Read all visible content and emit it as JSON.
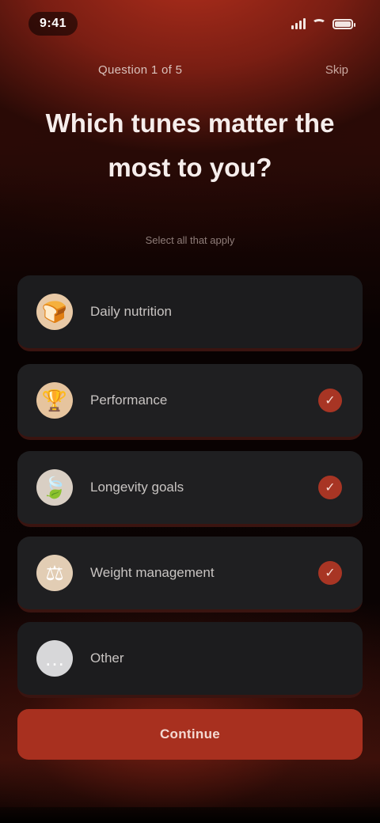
{
  "status_bar": {
    "time": "9:41",
    "icons": [
      "signal-icon",
      "wifi-icon",
      "battery-icon"
    ]
  },
  "nav": {
    "title": "Question 1 of 5",
    "skip_label": "Skip"
  },
  "heading": "Which tunes matter the most to you?",
  "subheading": "Select all that apply",
  "options": [
    {
      "icon": "bread-icon",
      "glyph": "🍞",
      "label": "Daily nutrition",
      "selected": false,
      "icon_bg": "#e8c9a6"
    },
    {
      "icon": "trophy-icon",
      "glyph": "🏆",
      "label": "Performance",
      "selected": true,
      "icon_bg": "#e6c49e"
    },
    {
      "icon": "leaf-icon",
      "glyph": "🍃",
      "label": "Longevity goals",
      "selected": true,
      "icon_bg": "#d9cfc4"
    },
    {
      "icon": "scale-icon",
      "glyph": "⚖",
      "label": "Weight management",
      "selected": true,
      "icon_bg": "#e2cdb4"
    },
    {
      "icon": "more-icon",
      "glyph": "…",
      "label": "Other",
      "selected": false,
      "icon_bg": "#d7d7d9"
    }
  ],
  "check_glyph": "✓",
  "continue_label": "Continue",
  "colors": {
    "accent": "#a8301f",
    "card": "#1c1c1e",
    "background": "#0a0303"
  }
}
